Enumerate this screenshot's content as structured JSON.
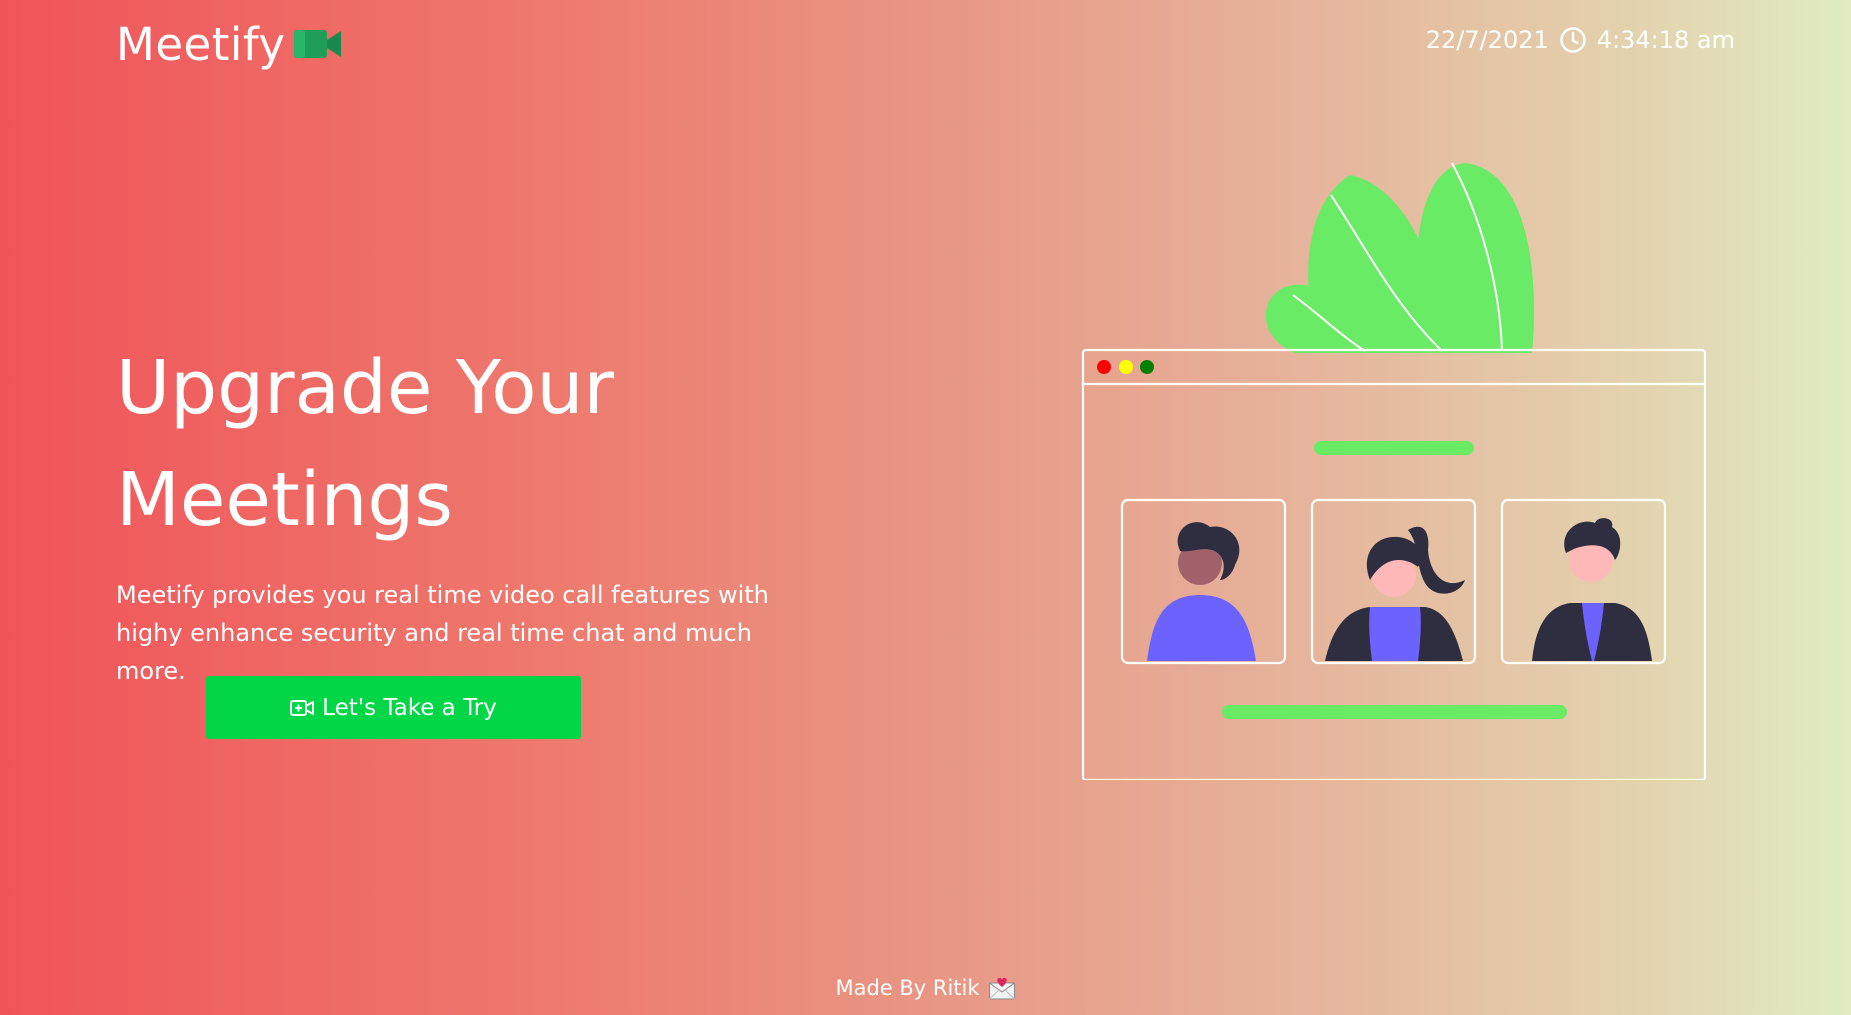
{
  "header": {
    "brand_name": "Meetify",
    "brand_icon": "video-camera-icon",
    "date": "22/7/2021",
    "time": "4:34:18 am",
    "clock_icon": "clock-icon"
  },
  "hero": {
    "title_line1": "Upgrade Your",
    "title_line2": "Meetings",
    "description_line1": "Meetify provides you real time video call features with",
    "description_line2": "highy enhance security and real time chat and much more.",
    "cta_label": "Let's Take a Try",
    "cta_icon": "video-add-icon"
  },
  "illustration": {
    "window_dots_colors": [
      "#ff0000",
      "#ffff00",
      "#008000"
    ],
    "accent_color": "#6aeb65",
    "shirt_color": "#6c63ff",
    "hair_color": "#2f2e41"
  },
  "footer": {
    "label": "Made By Ritik",
    "icon": "love-letter-icon"
  },
  "colors": {
    "cta_background": "#00d646",
    "gradient_start": "#f05459",
    "gradient_end": "#e0ecc3"
  }
}
